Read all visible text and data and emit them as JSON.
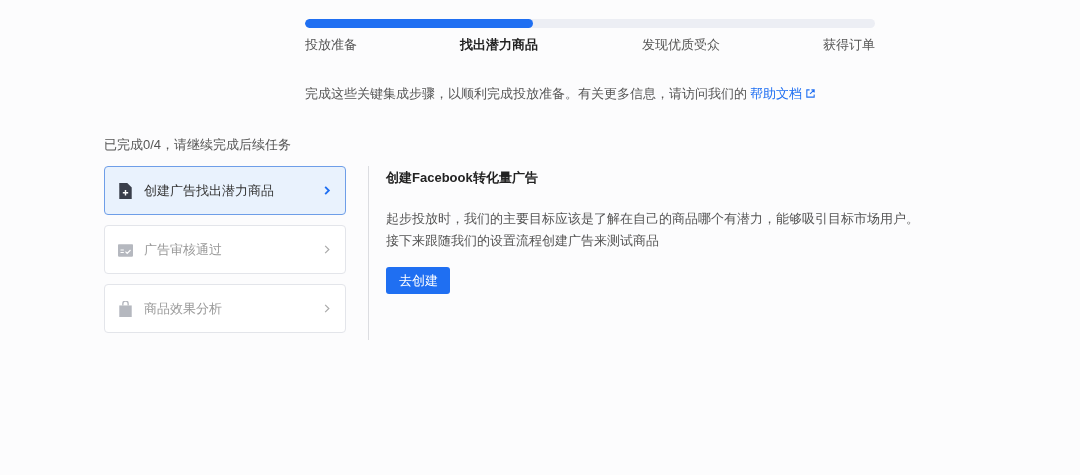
{
  "progress": {
    "level": 0.4
  },
  "steps": [
    {
      "label": "投放准备",
      "selected": false
    },
    {
      "label": "找出潜力商品",
      "selected": true
    },
    {
      "label": "发现优质受众",
      "selected": false
    },
    {
      "label": "获得订单",
      "selected": false
    }
  ],
  "intro": {
    "text": "完成这些关键集成步骤，以顺利完成投放准备。有关更多信息，请访问我们的",
    "link": "帮助文档"
  },
  "completion": "已完成0/4，请继续完成后续任务",
  "tasks": [
    {
      "kind": "document",
      "label": "创建广告找出潜力商品",
      "selected": true
    },
    {
      "kind": "calendar",
      "label": "广告审核通过",
      "selected": false
    },
    {
      "kind": "bag",
      "label": "商品效果分析",
      "selected": false
    }
  ],
  "detail": {
    "title": "创建Facebook转化量广告",
    "lines": [
      "起步投放时，我们的主要目标应该是了解在自己的商品哪个有潜力，能够吸引目标市场用户。",
      "接下来跟随我们的设置流程创建广告来测试商品"
    ],
    "button": "去创建"
  }
}
